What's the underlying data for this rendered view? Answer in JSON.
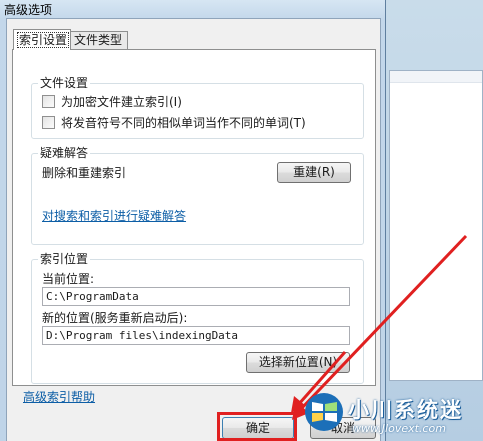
{
  "window": {
    "title": "高级选项",
    "close_glyph": "✕"
  },
  "tabs": [
    {
      "label": "索引设置",
      "active": true
    },
    {
      "label": "文件类型",
      "active": false
    }
  ],
  "file_settings": {
    "title": "文件设置",
    "options": [
      {
        "label": "为加密文件建立索引(I)",
        "checked": false
      },
      {
        "label": "将发音符号不同的相似单词当作不同的单词(T)",
        "checked": false
      }
    ]
  },
  "troubleshoot": {
    "title": "疑难解答",
    "rebuild_text": "删除和重建索引",
    "rebuild_button": "重建(R)",
    "link": "对搜索和索引进行疑难解答"
  },
  "index_location": {
    "title": "索引位置",
    "current_label": "当前位置:",
    "current_value": "C:\\ProgramData",
    "new_label": "新的位置(服务重新启动后):",
    "new_value": "D:\\Program files\\indexingData",
    "select_button": "选择新位置(N)"
  },
  "help_link": "高级索引帮助",
  "buttons": {
    "ok": "确定",
    "cancel": "取消"
  },
  "watermark": {
    "brand": "小川系统迷",
    "url": "www.Jlovext.com"
  },
  "colors": {
    "link": "#0d5ea6",
    "highlight": "#e02020"
  }
}
